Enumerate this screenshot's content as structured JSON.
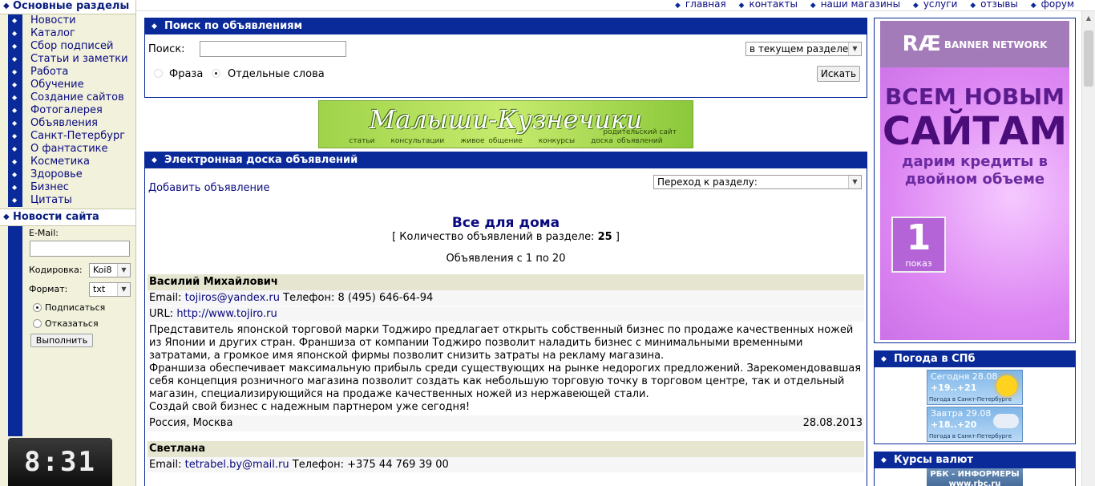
{
  "left": {
    "sections_title": "Основные разделы",
    "nav": [
      "Новости",
      "Каталог",
      "Сбор подписей",
      "Статьи и заметки",
      "Работа",
      "Обучение",
      "Создание сайтов",
      "Фотогалерея",
      "Объявления",
      "Санкт-Петербург",
      "О фантастике",
      "Косметика",
      "Здоровье",
      "Бизнес",
      "Цитаты"
    ],
    "news_title": "Новости сайта",
    "email_label": "E-Mail:",
    "encoding_label": "Кодировка:",
    "encoding_value": "Koi8",
    "format_label": "Формат:",
    "format_value": "txt",
    "subscribe": "Подписаться",
    "unsubscribe": "Отказаться",
    "submit": "Выполнить",
    "clock": "8:31"
  },
  "topnav": [
    "главная",
    "контакты",
    "наши магазины",
    "услуги",
    "отзывы",
    "форум"
  ],
  "search": {
    "title": "Поиск по объявлениям",
    "label": "Поиск:",
    "scope": "в текущем разделе",
    "phrase": "Фраза",
    "words": "Отдельные слова",
    "button": "Искать"
  },
  "banner": {
    "title": "Малыши-Кузнечики",
    "subtitle": "родительский сайт",
    "links": [
      "статьи",
      "консультации",
      "живое общение",
      "конкурсы",
      "доска объявлений"
    ]
  },
  "board": {
    "title": "Электронная доска объявлений",
    "add_link": "Добавить объявление",
    "jump": "Переход к разделу:",
    "category": "Все для дома",
    "count_prefix": "[ Количество объявлений в разделе:",
    "count": "25",
    "count_suffix": "]",
    "range": "Объявления с 1 по 20"
  },
  "ads": [
    {
      "name": "Василий Михайлович",
      "email_label": "Email:",
      "email": "tojiros@yandex.ru",
      "phone_label": "Телефон:",
      "phone": "8 (495) 646-64-94",
      "url_label": "URL:",
      "url": "http://www.tojiro.ru",
      "text1": "Представитель японской торговой марки Тоджиро предлагает открыть собственный бизнес по продаже качественных ножей из Японии и других стран. Франшиза от компании Тоджиро позволит наладить бизнес с минимальными временными затратами, а громкое имя японской фирмы позволит снизить затраты на рекламу магазина.",
      "text2": "Франшиза обеспечивает максимальную прибыль среди существующих на рынке недорогих предложений. Зарекомендовавшая себя концепция розничного магазина позволит создать как небольшую торговую точку в торговом центре, так и отдельный магазин, специализирующийся на продаже качественных ножей из нержавеющей стали.",
      "text3": "Создай свой бизнес с надежным партнером уже сегодня!",
      "location": "Россия, Москва",
      "date": "28.08.2013"
    },
    {
      "name": "Светлана",
      "email_label": "Email:",
      "email": "tetrabel.by@mail.ru",
      "phone_label": "Телефон:",
      "phone": "+375 44 769 39 00"
    }
  ],
  "right": {
    "banner_logo": "RÆ",
    "banner_logo_text": "BANNER NETWORK",
    "banner_l1": "ВСЕМ НОВЫМ",
    "banner_l2": "САЙТАМ",
    "banner_l3": "дарим кредиты в двойном объеме",
    "badge_number": "1",
    "badge_text": "показ",
    "weather_title": "Погода в СПб",
    "today_date": "Сегодня 28.08",
    "today_temp": "+19..+21",
    "tomorrow_date": "Завтра 29.08",
    "tomorrow_temp": "+18..+20",
    "weather_caption": "Погода в Санкт-Петербурге",
    "currency_title": "Курсы валют",
    "rbc_line1": "РБК - ИНФОРМЕРЫ",
    "rbc_line2": "www.rbc.ru"
  },
  "colors": {
    "accent": "#0a2a9a",
    "link": "#0a0a80",
    "sidebar_bg": "#f1f1dc",
    "row_bg": "#e5e5d0"
  }
}
